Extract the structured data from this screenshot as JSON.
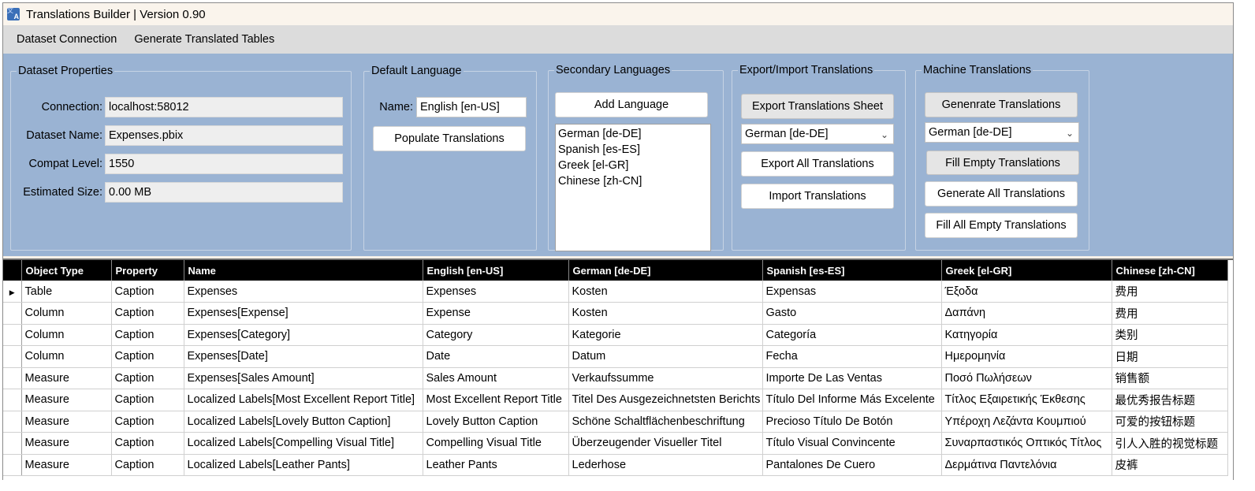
{
  "window": {
    "title": "Translations Builder | Version 0.90",
    "icon": "translate-app-icon"
  },
  "menu": {
    "items": [
      "Dataset Connection",
      "Generate Translated Tables"
    ]
  },
  "dataset_properties": {
    "legend": "Dataset Properties",
    "connection_label": "Connection:",
    "connection_value": "localhost:58012",
    "name_label": "Dataset Name:",
    "name_value": "Expenses.pbix",
    "compat_label": "Compat Level:",
    "compat_value": "1550",
    "size_label": "Estimated Size:",
    "size_value": "0.00 MB"
  },
  "default_language": {
    "legend": "Default Language",
    "name_label": "Name:",
    "name_value": "English [en-US]",
    "populate_button": "Populate Translations"
  },
  "secondary_languages": {
    "legend": "Secondary Languages",
    "add_button": "Add Language",
    "items": [
      "German [de-DE]",
      "Spanish [es-ES]",
      "Greek [el-GR]",
      "Chinese [zh-CN]"
    ]
  },
  "export_import": {
    "legend": "Export/Import Translations",
    "export_sheet_button": "Export Translations Sheet",
    "language_selected": "German [de-DE]",
    "export_all_button": "Export All Translations",
    "import_button": "Import Translations"
  },
  "machine_translations": {
    "legend": "Machine Translations",
    "generate_button": "Genenrate Translations",
    "language_selected": "German [de-DE]",
    "fill_empty_button": "Fill Empty Translations",
    "generate_all_button": "Generate All Translations",
    "fill_all_empty_button": "Fill All Empty Translations"
  },
  "grid": {
    "columns": [
      "Object Type",
      "Property",
      "Name",
      "English [en-US]",
      "German [de-DE]",
      "Spanish [es-ES]",
      "Greek [el-GR]",
      "Chinese [zh-CN]"
    ],
    "rows": [
      [
        "Table",
        "Caption",
        "Expenses",
        "Expenses",
        "Kosten",
        "Expensas",
        "Έξοδα",
        "费用"
      ],
      [
        "Column",
        "Caption",
        "Expenses[Expense]",
        "Expense",
        "Kosten",
        "Gasto",
        "Δαπάνη",
        "费用"
      ],
      [
        "Column",
        "Caption",
        "Expenses[Category]",
        "Category",
        "Kategorie",
        "Categoría",
        "Κατηγορία",
        "类别"
      ],
      [
        "Column",
        "Caption",
        "Expenses[Date]",
        "Date",
        "Datum",
        "Fecha",
        "Ημερομηνία",
        "日期"
      ],
      [
        "Measure",
        "Caption",
        "Expenses[Sales Amount]",
        "Sales Amount",
        "Verkaufssumme",
        "Importe De Las Ventas",
        "Ποσό Πωλήσεων",
        "销售额"
      ],
      [
        "Measure",
        "Caption",
        "Localized Labels[Most Excellent Report Title]",
        "Most Excellent Report Title",
        "Titel Des Ausgezeichnetsten Berichts",
        "Título Del Informe Más Excelente",
        "Τίτλος Εξαιρετικής Έκθεσης",
        "最优秀报告标题"
      ],
      [
        "Measure",
        "Caption",
        "Localized Labels[Lovely Button Caption]",
        "Lovely Button Caption",
        "Schöne Schaltflächenbeschriftung",
        "Precioso Título De Botón",
        "Υπέροχη Λεζάντα Κουμπιού",
        "可爱的按钮标题"
      ],
      [
        "Measure",
        "Caption",
        "Localized Labels[Compelling Visual Title]",
        "Compelling Visual Title",
        "Überzeugender Visueller Titel",
        "Título Visual Convincente",
        "Συναρπαστικός Οπτικός Τίτλος",
        "引人入胜的视觉标题"
      ],
      [
        "Measure",
        "Caption",
        "Localized Labels[Leather Pants]",
        "Leather Pants",
        "Lederhose",
        "Pantalones De Cuero",
        "Δερμάτινα Παντελόνια",
        "皮裤"
      ]
    ]
  }
}
